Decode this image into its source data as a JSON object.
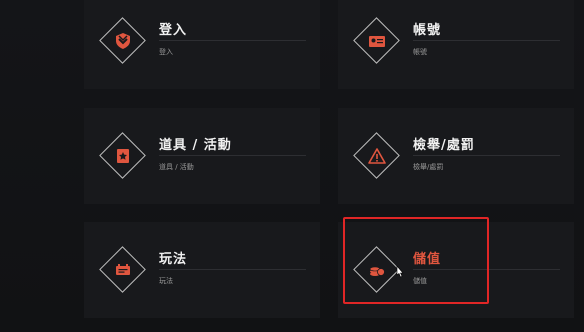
{
  "cards": [
    {
      "title": "登入",
      "subtitle": "登入",
      "icon": "login-shield-icon"
    },
    {
      "title": "帳號",
      "subtitle": "帳號",
      "icon": "id-card-icon"
    },
    {
      "title": "道具 / 活動",
      "subtitle": "道具 / 活動",
      "icon": "event-book-icon"
    },
    {
      "title": "檢舉/處罰",
      "subtitle": "檢舉/處罰",
      "icon": "warning-icon"
    },
    {
      "title": "玩法",
      "subtitle": "玩法",
      "icon": "gameplay-ticket-icon"
    },
    {
      "title": "儲值",
      "subtitle": "儲值",
      "icon": "coins-icon",
      "selected": true
    }
  ],
  "colors": {
    "accent": "#e0563f",
    "highlight_box": "#e02626",
    "card_bg": "#18191c",
    "page_bg": "#121316"
  }
}
